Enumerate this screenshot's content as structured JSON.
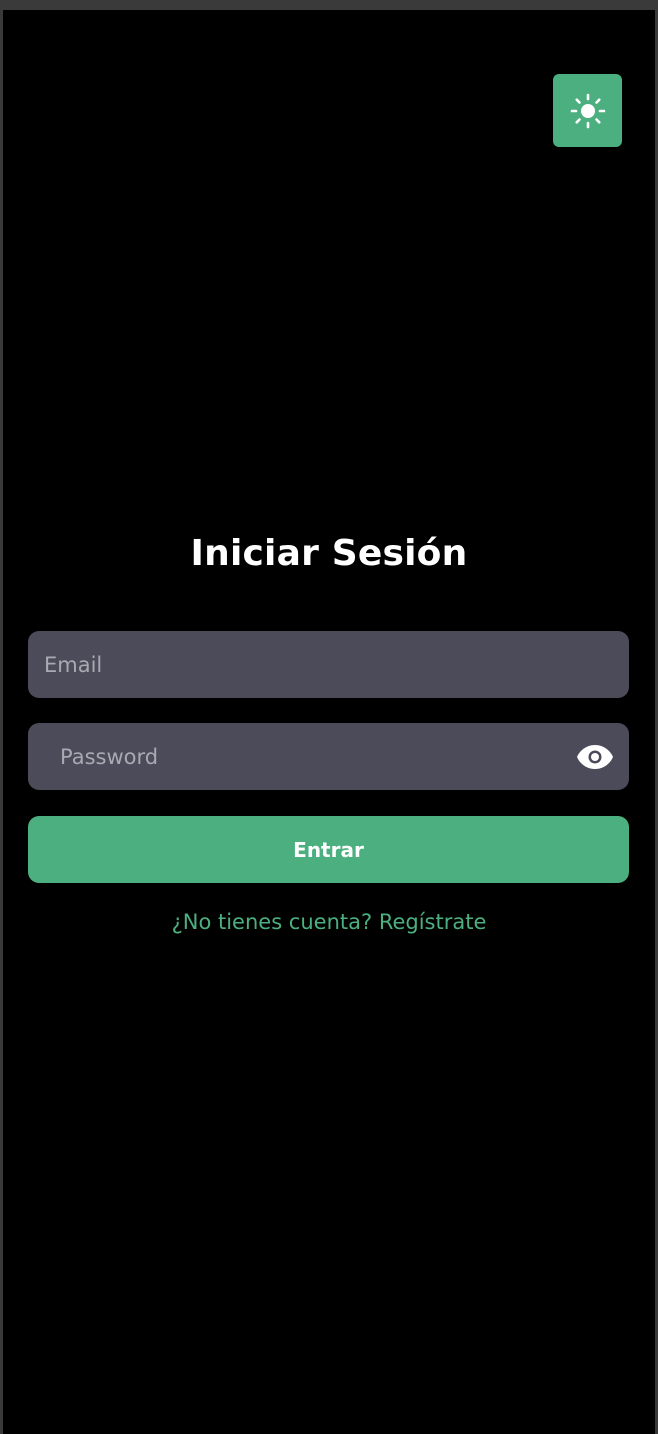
{
  "theme_toggle": {
    "icon": "sun-icon",
    "color": "#4caf7f"
  },
  "login": {
    "title": "Iniciar Sesión",
    "email_placeholder": "Email",
    "email_value": "",
    "password_placeholder": "Password",
    "password_value": "",
    "password_toggle_icon": "eye-icon",
    "submit_label": "Entrar",
    "register_link": "¿No tienes cuenta? Regístrate"
  },
  "colors": {
    "background": "#000000",
    "accent": "#4caf7f",
    "input_background": "#4b4b59"
  }
}
